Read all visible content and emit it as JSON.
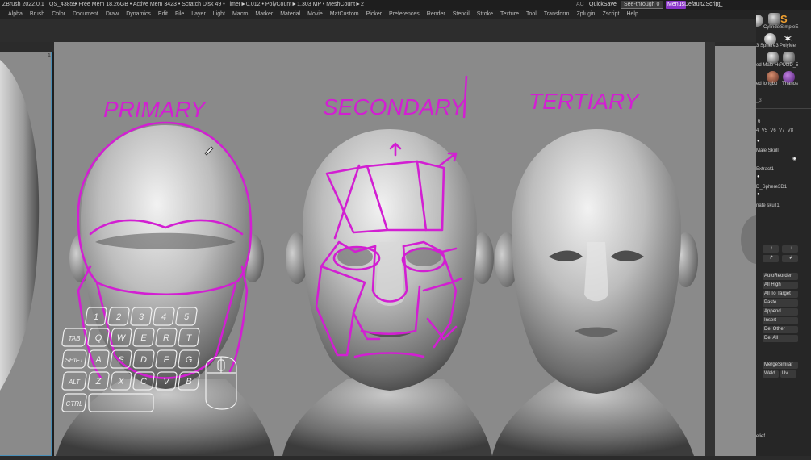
{
  "titlebar": {
    "app": "ZBrush 2022.0.1",
    "project": "QS_43859",
    "stats": "• Free Mem 18.26GB • Active Mem 3423 • Scratch Disk 49 • Timer►0.012 • PolyCount►1.303 MP • MeshCount►2",
    "ac": "AC",
    "quicksave": "QuickSave",
    "seethrough": "See-through",
    "seethrough_value": "0",
    "menus_button": "Menus",
    "zscript": "DefaultZScript"
  },
  "menubar": [
    "Alpha",
    "Brush",
    "Color",
    "Document",
    "Draw",
    "Dynamics",
    "Edit",
    "File",
    "Layer",
    "Light",
    "Macro",
    "Marker",
    "Material",
    "Movie",
    "MatCustom",
    "Picker",
    "Preferences",
    "Render",
    "Stencil",
    "Stroke",
    "Texture",
    "Tool",
    "Transform",
    "Zplugin",
    "Zscript",
    "Help"
  ],
  "canvas": {
    "labels": {
      "primary": "PRIMARY",
      "secondary": "SECONDARY",
      "tertiary": "TERTIARY"
    },
    "annotation_color": "#d21fd2",
    "canvas_bg": "#8a8a8a"
  },
  "keyboard": {
    "row1": [
      "1",
      "2",
      "3",
      "4",
      "5"
    ],
    "row2": [
      "TAB",
      "Q",
      "W",
      "E",
      "R",
      "T"
    ],
    "row3": [
      "SHIFT",
      "A",
      "S",
      "D",
      "F",
      "G"
    ],
    "row4": [
      "ALT",
      "Z",
      "X",
      "C",
      "V",
      "B"
    ],
    "row5": [
      "CTRL"
    ]
  },
  "palette": {
    "tools_top": [
      "Cylinde",
      "SimpleE"
    ],
    "tools_mid": [
      "3 Sphere3",
      "PolyMe"
    ],
    "tools_labels": [
      "ed Male He",
      "PM3D_5"
    ],
    "tools_labels2": [
      "ed longbo",
      "Thanos"
    ],
    "count_small": "_3",
    "subtool_count": "6",
    "versions": [
      "4",
      "V5",
      "V6",
      "V7",
      "V8"
    ],
    "subtools": [
      "Male Skull",
      "Extract1",
      "D_Sphere3D1",
      "nate skull1"
    ],
    "buttons": [
      "AutoReorder",
      "All High",
      "All To Target",
      "Paste",
      "Append",
      "Insert",
      "Del Other",
      "Del All"
    ],
    "bottom_buttons": [
      "MergeSimilar",
      "Weld",
      "Uv"
    ],
    "relief_label": "elief"
  }
}
